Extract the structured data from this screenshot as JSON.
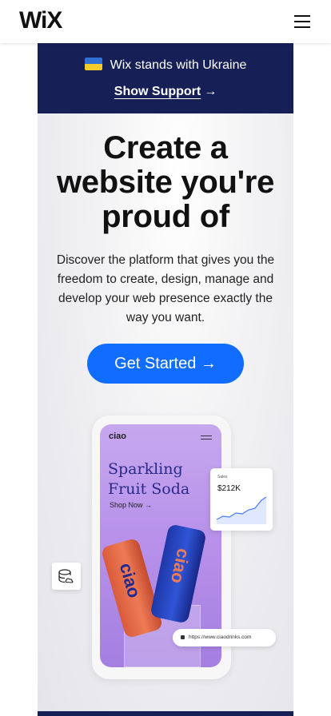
{
  "header": {
    "logo_text": "WiX",
    "menu_icon": "hamburger-menu-icon"
  },
  "banner": {
    "text": "Wix stands with Ukraine",
    "link_label": "Show Support",
    "link_arrow": "→",
    "flag_icon": "ukraine-flag-icon",
    "background": "#162056"
  },
  "hero": {
    "title_line1": "Create a",
    "title_line2": "website you're",
    "title_line3": "proud of",
    "description": "Discover the platform that gives you the freedom to create, design, manage and develop your web presence exactly the way you want.",
    "cta_label": "Get Started →",
    "cta_color": "#116dff"
  },
  "mockup": {
    "brand": "ciao",
    "headline_line1": "Sparkling",
    "headline_line2": "Fruit Soda",
    "shop_now": "Shop Now →",
    "can_text": "ciao",
    "sales_label": "Sales",
    "sales_value": "$212K",
    "url": "https://www.ciaodrinks.com",
    "storage_icon": "database-icon"
  }
}
